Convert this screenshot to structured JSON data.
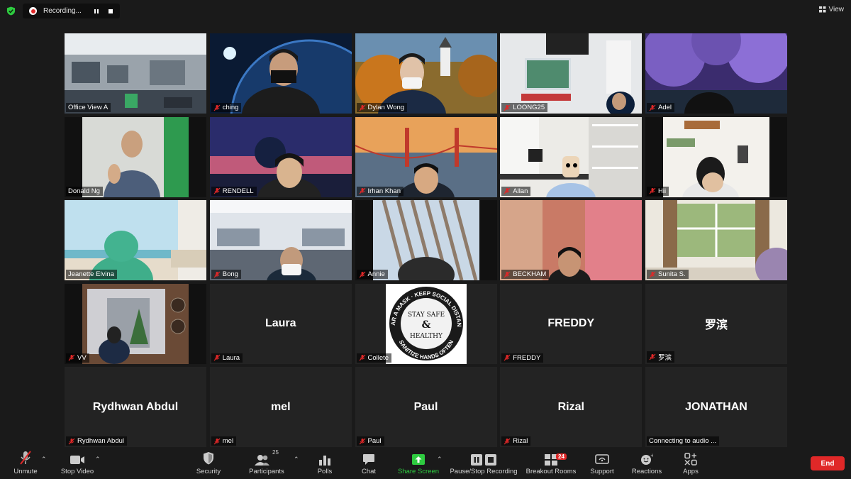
{
  "recording": {
    "label": "Recording..."
  },
  "view": {
    "label": "View"
  },
  "tiles": [
    {
      "name": "Office View A",
      "muted": false,
      "big": ""
    },
    {
      "name": "ching",
      "muted": true,
      "big": ""
    },
    {
      "name": "Dylan Wong",
      "muted": true,
      "big": ""
    },
    {
      "name": "LOONG25",
      "muted": true,
      "big": ""
    },
    {
      "name": "Adel",
      "muted": true,
      "big": ""
    },
    {
      "name": "Donald Ng",
      "muted": false,
      "big": ""
    },
    {
      "name": "RENDELL",
      "muted": true,
      "big": ""
    },
    {
      "name": "Irhan Khan",
      "muted": true,
      "big": ""
    },
    {
      "name": "Allan",
      "muted": true,
      "big": ""
    },
    {
      "name": "Hii",
      "muted": true,
      "big": ""
    },
    {
      "name": "Jeanette Elvina",
      "muted": false,
      "big": ""
    },
    {
      "name": "Bong",
      "muted": true,
      "big": ""
    },
    {
      "name": "Annie",
      "muted": true,
      "big": ""
    },
    {
      "name": "BECKHAM",
      "muted": true,
      "big": ""
    },
    {
      "name": "Sunita S.",
      "muted": true,
      "big": ""
    },
    {
      "name": "VV",
      "muted": true,
      "big": ""
    },
    {
      "name": "Laura",
      "muted": true,
      "big": "Laura"
    },
    {
      "name": "Collete",
      "muted": true,
      "big": ""
    },
    {
      "name": "FREDDY",
      "muted": true,
      "big": "FREDDY"
    },
    {
      "name": "罗滨",
      "muted": true,
      "big": "罗滨"
    },
    {
      "name": "Rydhwan Abdul",
      "muted": true,
      "big": "Rydhwan Abdul"
    },
    {
      "name": "mel",
      "muted": true,
      "big": "mel"
    },
    {
      "name": "Paul",
      "muted": true,
      "big": "Paul"
    },
    {
      "name": "Rizal",
      "muted": true,
      "big": "Rizal"
    },
    {
      "name": "Connecting to audio ...",
      "muted": false,
      "big": "JONATHAN"
    }
  ],
  "poster": {
    "arc_top": "WEAR A MASK · KEEP SOCIAL DISTANCE",
    "arc_bottom": "SANITIZE HANDS OFTEN",
    "line1": "STAY SAFE",
    "amp": "&",
    "line2": "HEALTHY"
  },
  "toolbar": {
    "unmute": "Unmute",
    "stop_video": "Stop Video",
    "security": "Security",
    "participants": "Participants",
    "participants_count": "25",
    "polls": "Polls",
    "chat": "Chat",
    "share_screen": "Share Screen",
    "pause_stop_recording": "Pause/Stop Recording",
    "breakout_rooms": "Breakout Rooms",
    "breakout_badge": "24",
    "support": "Support",
    "reactions": "Reactions",
    "apps": "Apps",
    "end": "End"
  },
  "colors": {
    "background": "#1a1a1a",
    "tile": "#232323",
    "active_outline": "#c8e650",
    "end_red": "#e02828",
    "share_green": "#2ecc40"
  }
}
